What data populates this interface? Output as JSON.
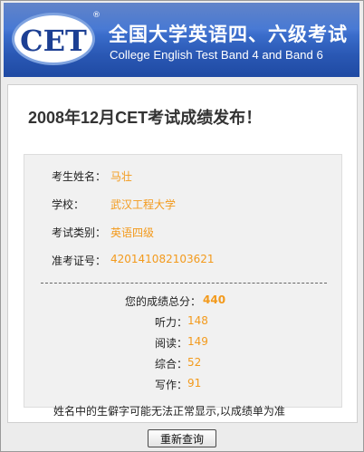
{
  "banner": {
    "logo_text": "CET",
    "registered_mark": "®",
    "title_cn": "全国大学英语四、六级考试",
    "title_en": "College English Test Band 4 and Band 6",
    "colors": {
      "background": "#2e5cb8",
      "logo_text": "#1c3f93"
    }
  },
  "page": {
    "title": "2008年12月CET考试成绩发布！"
  },
  "candidate": {
    "fields": [
      {
        "label": "考生姓名：",
        "value": "马壮"
      },
      {
        "label": "学校：",
        "value": "武汉工程大学"
      },
      {
        "label": "考试类别：",
        "value": "英语四级"
      },
      {
        "label": "准考证号：",
        "value": "420141082103621"
      }
    ]
  },
  "scores": {
    "total_label": "您的成绩总分：",
    "total_value": "440",
    "items": [
      {
        "label": "听力：",
        "value": "148"
      },
      {
        "label": "阅读：",
        "value": "149"
      },
      {
        "label": "综合：",
        "value": "52"
      },
      {
        "label": "写作：",
        "value": "91"
      }
    ]
  },
  "note": "姓名中的生僻字可能无法正常显示,以成绩单为准",
  "requery_button": "重新查询",
  "colors": {
    "value_text": "#f39a1c",
    "panel_background": "#f1f1f1"
  }
}
